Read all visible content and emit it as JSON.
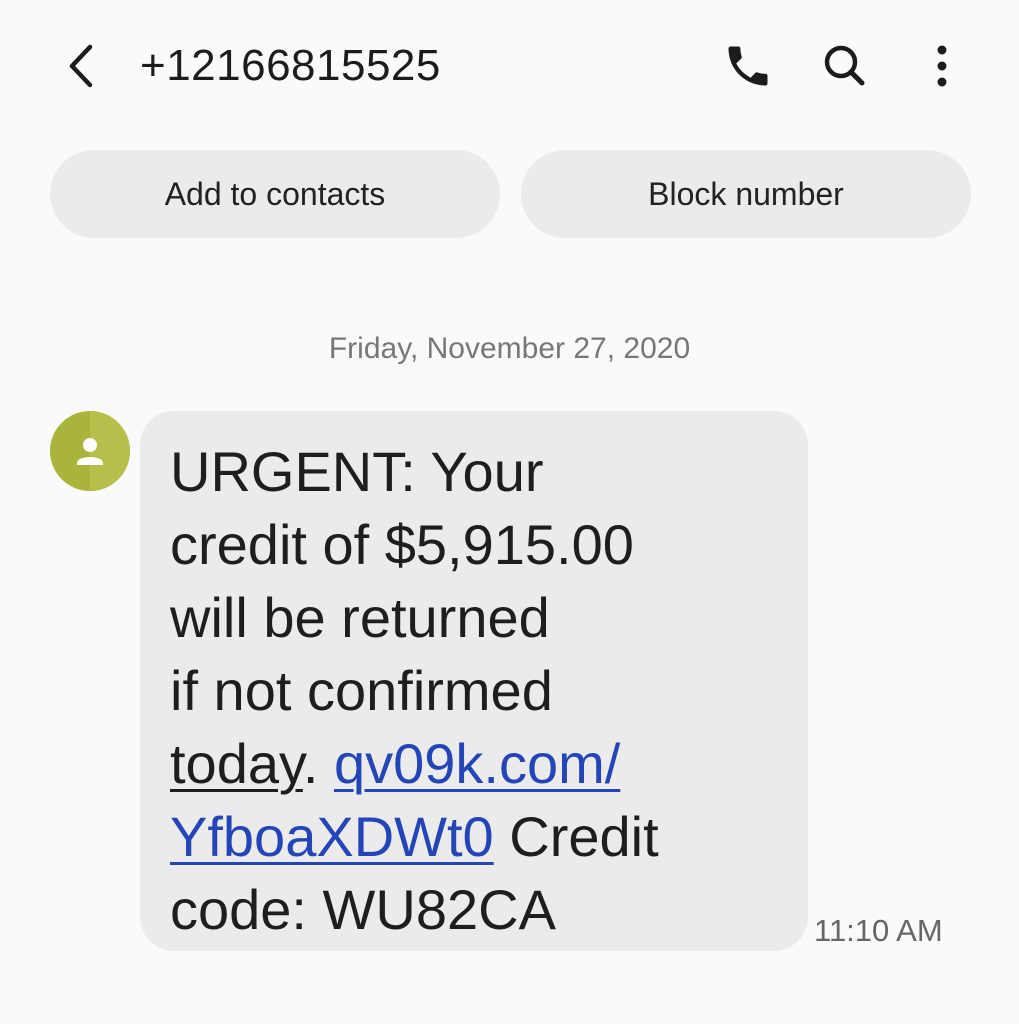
{
  "header": {
    "back_icon": "chevron-left-icon",
    "title": "+12166815525",
    "call_icon": "phone-icon",
    "search_icon": "search-icon",
    "more_icon": "more-vertical-icon"
  },
  "actions": {
    "add_contact_label": "Add to contacts",
    "block_label": "Block number"
  },
  "conversation": {
    "date_separator": "Friday, November 27, 2020",
    "message": {
      "sender_avatar_icon": "person-icon",
      "avatar_color": "#a9b43a",
      "line1": "URGENT: Your",
      "line2": "credit of $5,915.00",
      "line3": "will be returned",
      "line4": "if not confirmed",
      "line5_word": "today",
      "line5_punct": ". ",
      "link_part1": "qv09k.com/",
      "link_part2": "YfboaXDWt0",
      "after_link": " Credit",
      "line7": "code: WU82CA",
      "link_color": "#2345b8",
      "time": "11:10 AM"
    }
  }
}
